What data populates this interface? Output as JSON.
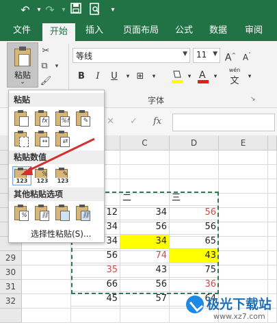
{
  "titlebar": {
    "undo_icon": "undo-icon",
    "redo_icon": "redo-icon",
    "save_icon": "save-icon",
    "print_preview_icon": "print-preview-icon"
  },
  "tabs": [
    "文件",
    "开始",
    "插入",
    "页面布局",
    "公式",
    "数据",
    "审阅"
  ],
  "active_tab": "开始",
  "ribbon": {
    "paste_label": "粘贴",
    "font_name": "等线",
    "font_size": "11",
    "font_group_label": "字体",
    "bold": "B",
    "italic": "I",
    "underline": "U",
    "grow_font": "A",
    "shrink_font": "A",
    "phonetic_top": "wén",
    "phonetic_bottom": "文"
  },
  "formula_bar": {
    "cancel": "✕",
    "enter": "✓",
    "fx": "fx",
    "value": ""
  },
  "paste_menu": {
    "section_paste": "粘贴",
    "section_values": "粘贴数值",
    "section_other": "其他粘贴选项",
    "special": "选择性粘贴(S)...",
    "values_label": "123"
  },
  "columns": [
    "C",
    "D",
    "E"
  ],
  "rows": [
    {
      "num": "",
      "b": "",
      "c": "二",
      "d": "三"
    },
    {
      "num": "",
      "b": "12",
      "c": "34",
      "d": "56"
    },
    {
      "num": "",
      "b": "34",
      "c": "56",
      "d": "56"
    },
    {
      "num": "",
      "b": "34",
      "c": "34",
      "d": "65"
    },
    {
      "num": "29",
      "b": "56",
      "c": "74",
      "d": "43"
    },
    {
      "num": "30",
      "b": "35",
      "c": "43",
      "d": "75"
    },
    {
      "num": "31",
      "b": "66",
      "c": "56",
      "d": "36"
    },
    {
      "num": "32",
      "b": "45",
      "c": "57",
      "d": "64"
    }
  ],
  "colors": {
    "excel_green": "#217346",
    "highlight": "#ffff00",
    "red_text": "#d64545",
    "arrow": "#d32f2f"
  },
  "watermark": {
    "name": "极光下载站",
    "url": "www.xz7.com"
  }
}
